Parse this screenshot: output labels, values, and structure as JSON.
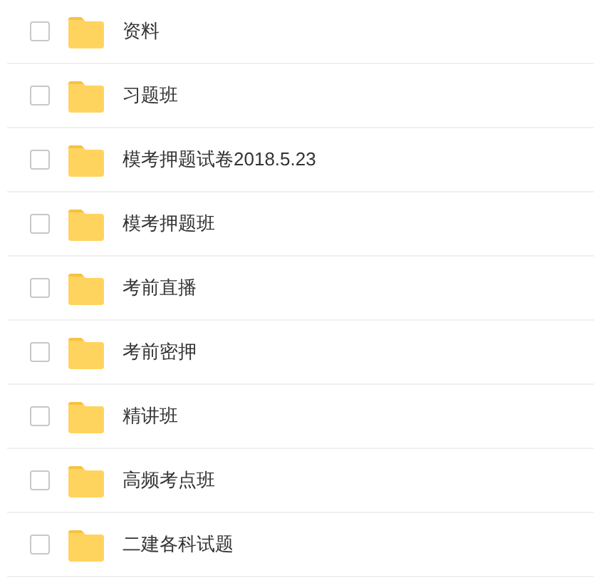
{
  "files": [
    {
      "name": "资料",
      "checked": false
    },
    {
      "name": "习题班",
      "checked": false
    },
    {
      "name": "模考押题试卷2018.5.23",
      "checked": false
    },
    {
      "name": "模考押题班",
      "checked": false
    },
    {
      "name": "考前直播",
      "checked": false
    },
    {
      "name": "考前密押",
      "checked": false
    },
    {
      "name": "精讲班",
      "checked": false
    },
    {
      "name": "高频考点班",
      "checked": false
    },
    {
      "name": "二建各科试题",
      "checked": false
    }
  ]
}
